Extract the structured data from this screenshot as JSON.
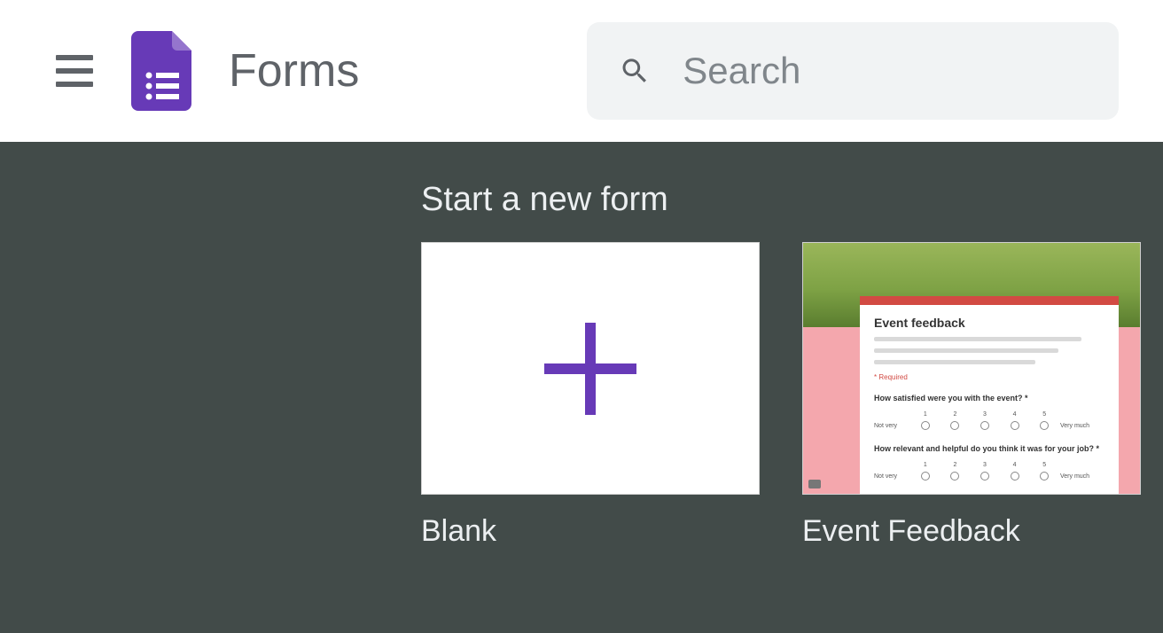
{
  "header": {
    "app_title": "Forms",
    "search_placeholder": "Search"
  },
  "template_section": {
    "heading": "Start a new form",
    "templates": [
      {
        "label": "Blank"
      },
      {
        "label": "Event Feedback"
      }
    ]
  },
  "preview": {
    "event_feedback": {
      "title": "Event feedback",
      "required_label": "* Required",
      "q1": "How satisfied were you with the event? *",
      "q2": "How relevant and helpful do you think it was for your job? *",
      "scale_low": "Not very",
      "scale_high": "Very much",
      "n1": "1",
      "n2": "2",
      "n3": "3",
      "n4": "4",
      "n5": "5"
    }
  },
  "colors": {
    "accent": "#673ab7",
    "header_text": "#5f6368",
    "template_bg": "#424b49"
  }
}
